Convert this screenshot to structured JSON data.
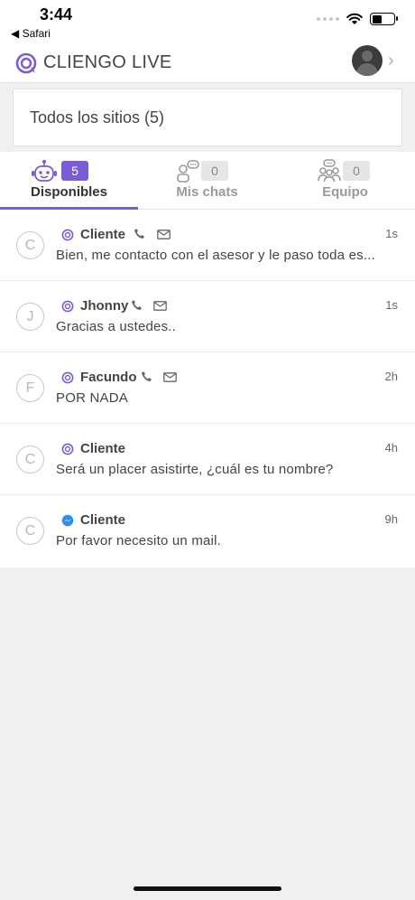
{
  "status_bar": {
    "time": "3:44",
    "back_label": "◀ Safari"
  },
  "header": {
    "title": "CLIENGO LIVE",
    "brand_color": "#7b5cd6"
  },
  "site_selector": {
    "label": "Todos los sitios (5)"
  },
  "tabs": [
    {
      "label": "Disponibles",
      "count": "5",
      "icon": "robot-icon",
      "active": true
    },
    {
      "label": "Mis chats",
      "count": "0",
      "icon": "agent-chat-icon",
      "active": false
    },
    {
      "label": "Equipo",
      "count": "0",
      "icon": "team-icon",
      "active": false
    }
  ],
  "chats": [
    {
      "initial": "C",
      "name": "Cliente",
      "channel": "cliengo-icon",
      "phone": true,
      "mail": true,
      "time": "1s",
      "message": "Bien, me contacto con el asesor y le paso toda es..."
    },
    {
      "initial": "J",
      "name": "Jhonny",
      "channel": "cliengo-icon",
      "phone": true,
      "mail": true,
      "time": "1s",
      "message": "Gracias a ustedes.."
    },
    {
      "initial": "F",
      "name": "Facundo",
      "channel": "cliengo-icon",
      "phone": true,
      "mail": true,
      "time": "2h",
      "message": "POR NADA"
    },
    {
      "initial": "C",
      "name": "Cliente",
      "channel": "cliengo-icon",
      "phone": false,
      "mail": false,
      "time": "4h",
      "message": "Será un placer asistirte, ¿cuál es tu nombre?"
    },
    {
      "initial": "C",
      "name": "Cliente",
      "channel": "messenger-icon",
      "phone": false,
      "mail": false,
      "time": "9h",
      "message": "Por favor necesito un mail."
    }
  ]
}
